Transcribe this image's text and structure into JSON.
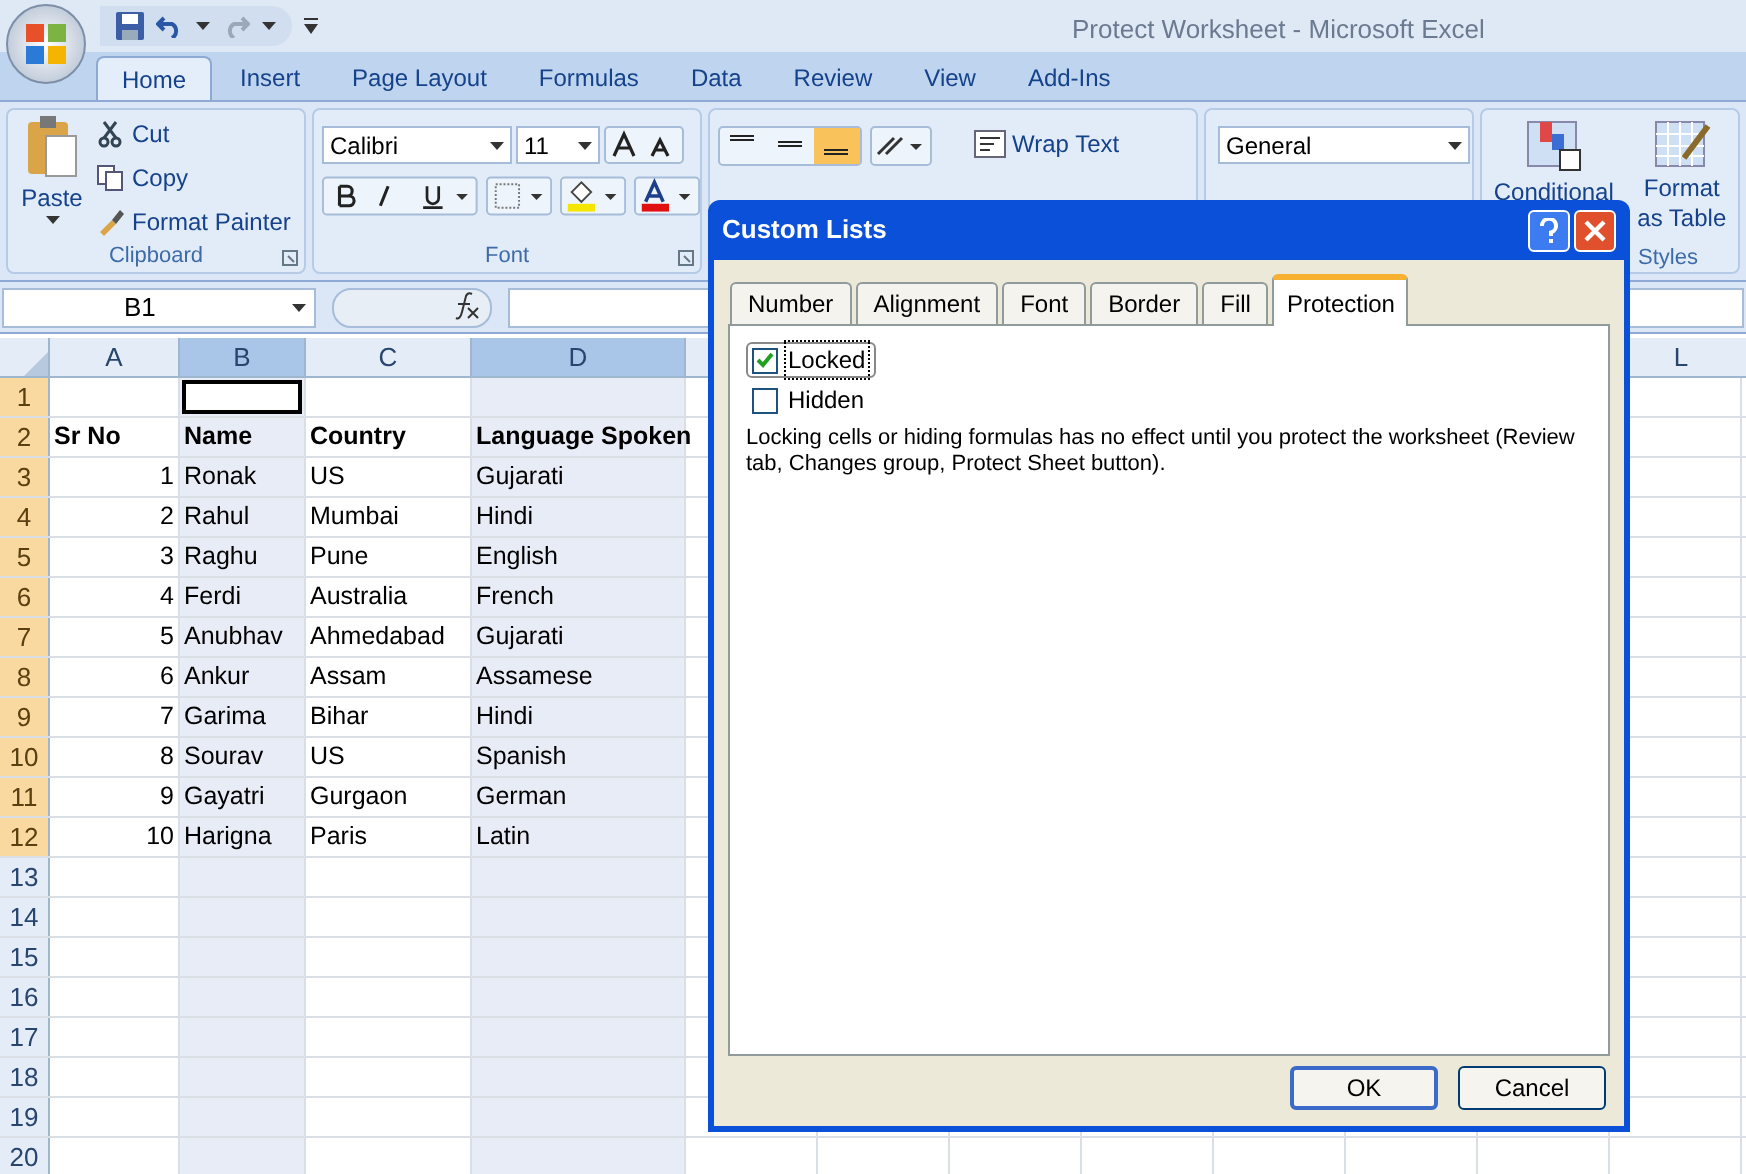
{
  "window": {
    "title": "Protect Worksheet - Microsoft Excel"
  },
  "ribbon_tabs": [
    {
      "label": "Home",
      "selected": true
    },
    {
      "label": "Insert",
      "selected": false
    },
    {
      "label": "Page Layout",
      "selected": false
    },
    {
      "label": "Formulas",
      "selected": false
    },
    {
      "label": "Data",
      "selected": false
    },
    {
      "label": "Review",
      "selected": false
    },
    {
      "label": "View",
      "selected": false
    },
    {
      "label": "Add-Ins",
      "selected": false
    }
  ],
  "clipboard": {
    "paste": "Paste",
    "cut": "Cut",
    "copy": "Copy",
    "format_painter": "Format Painter",
    "label": "Clipboard"
  },
  "font": {
    "name": "Calibri",
    "size": "11",
    "label": "Font"
  },
  "alignment": {
    "wrap_text": "Wrap Text"
  },
  "number": {
    "format": "General"
  },
  "styles": {
    "conditional": "Conditional",
    "format_as_table": "Format",
    "format_as_table_2": "as Table",
    "label": "Styles"
  },
  "formula_bar": {
    "name_box": "B1"
  },
  "sheet": {
    "columns": [
      {
        "label": "A",
        "selected": false
      },
      {
        "label": "B",
        "selected": true
      },
      {
        "label": "C",
        "selected": false
      },
      {
        "label": "D",
        "selected": true
      }
    ],
    "far_column": "L",
    "rows": [
      {
        "label": "1",
        "selected": true,
        "kind": "empty"
      },
      {
        "label": "2",
        "selected": true,
        "kind": "heading",
        "cells": [
          "Sr No",
          "Name",
          "Country",
          "Language Spoken"
        ]
      },
      {
        "label": "3",
        "selected": true,
        "kind": "data",
        "cells": [
          "1",
          "Ronak",
          "US",
          "Gujarati"
        ]
      },
      {
        "label": "4",
        "selected": true,
        "kind": "data",
        "cells": [
          "2",
          "Rahul",
          "Mumbai",
          "Hindi"
        ]
      },
      {
        "label": "5",
        "selected": true,
        "kind": "data",
        "cells": [
          "3",
          "Raghu",
          "Pune",
          "English"
        ]
      },
      {
        "label": "6",
        "selected": true,
        "kind": "data",
        "cells": [
          "4",
          "Ferdi",
          "Australia",
          "French"
        ]
      },
      {
        "label": "7",
        "selected": true,
        "kind": "data",
        "cells": [
          "5",
          "Anubhav",
          "Ahmedabad",
          "Gujarati"
        ]
      },
      {
        "label": "8",
        "selected": true,
        "kind": "data",
        "cells": [
          "6",
          "Ankur",
          "Assam",
          "Assamese"
        ]
      },
      {
        "label": "9",
        "selected": true,
        "kind": "data",
        "cells": [
          "7",
          "Garima",
          "Bihar",
          "Hindi"
        ]
      },
      {
        "label": "10",
        "selected": true,
        "kind": "data",
        "cells": [
          "8",
          "Sourav",
          "US",
          "Spanish"
        ]
      },
      {
        "label": "11",
        "selected": true,
        "kind": "data",
        "cells": [
          "9",
          "Gayatri",
          "Gurgaon",
          "German"
        ]
      },
      {
        "label": "12",
        "selected": true,
        "kind": "data",
        "cells": [
          "10",
          "Harigna",
          "Paris",
          "Latin"
        ]
      },
      {
        "label": "13",
        "selected": false,
        "kind": "empty"
      },
      {
        "label": "14",
        "selected": false,
        "kind": "empty"
      },
      {
        "label": "15",
        "selected": false,
        "kind": "empty"
      },
      {
        "label": "16",
        "selected": false,
        "kind": "empty"
      },
      {
        "label": "17",
        "selected": false,
        "kind": "empty"
      },
      {
        "label": "18",
        "selected": false,
        "kind": "empty"
      },
      {
        "label": "19",
        "selected": false,
        "kind": "empty"
      },
      {
        "label": "20",
        "selected": false,
        "kind": "empty"
      }
    ]
  },
  "dialog": {
    "title": "Custom Lists",
    "tabs": [
      {
        "label": "Number",
        "selected": false
      },
      {
        "label": "Alignment",
        "selected": false
      },
      {
        "label": "Font",
        "selected": false
      },
      {
        "label": "Border",
        "selected": false
      },
      {
        "label": "Fill",
        "selected": false
      },
      {
        "label": "Protection",
        "selected": true
      }
    ],
    "options": [
      {
        "label": "Locked",
        "checked": true,
        "focused": true
      },
      {
        "label": "Hidden",
        "checked": false,
        "focused": false
      }
    ],
    "note": "Locking cells or hiding formulas has no effect until you protect the worksheet (Review tab, Changes group, Protect Sheet button).",
    "buttons": [
      "OK",
      "Cancel"
    ]
  }
}
